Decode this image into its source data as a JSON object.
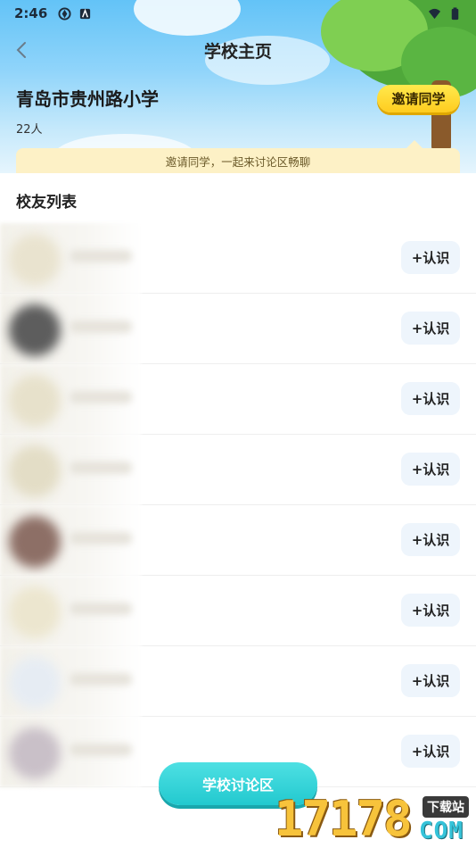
{
  "status_bar": {
    "time": "2:46",
    "icons": [
      "sync-icon",
      "app-notification-icon",
      "wifi-icon",
      "battery-icon"
    ]
  },
  "nav": {
    "title": "学校主页"
  },
  "school": {
    "name": "青岛市贵州路小学",
    "member_count": "22人",
    "invite_label": "邀请同学",
    "tip": "邀请同学，一起来讨论区畅聊"
  },
  "classmates": {
    "section_title": "校友列表",
    "rows": [
      {
        "button": "+认识",
        "avatar_color": "#e9e3cf"
      },
      {
        "button": "+认识",
        "avatar_color": "#5d5d5d"
      },
      {
        "button": "+认识",
        "avatar_color": "#e7e1cb"
      },
      {
        "button": "+认识",
        "avatar_color": "#e3ddc6"
      },
      {
        "button": "+认识",
        "avatar_color": "#8d6f66"
      },
      {
        "button": "+认识",
        "avatar_color": "#ece6cf"
      },
      {
        "button": "+认识",
        "avatar_color": "#e6ecf3"
      },
      {
        "button": "+认识",
        "avatar_color": "#c9c0c8"
      }
    ]
  },
  "forum_button": "学校讨论区",
  "watermark": {
    "number": "17178",
    "label": "下载站",
    "domain": "COM"
  },
  "colors": {
    "invite_yellow": "#ffd42a",
    "forum_teal": "#2fd2d8",
    "tip_bg": "#fdf1c6",
    "know_btn_bg": "#eef5fc"
  }
}
